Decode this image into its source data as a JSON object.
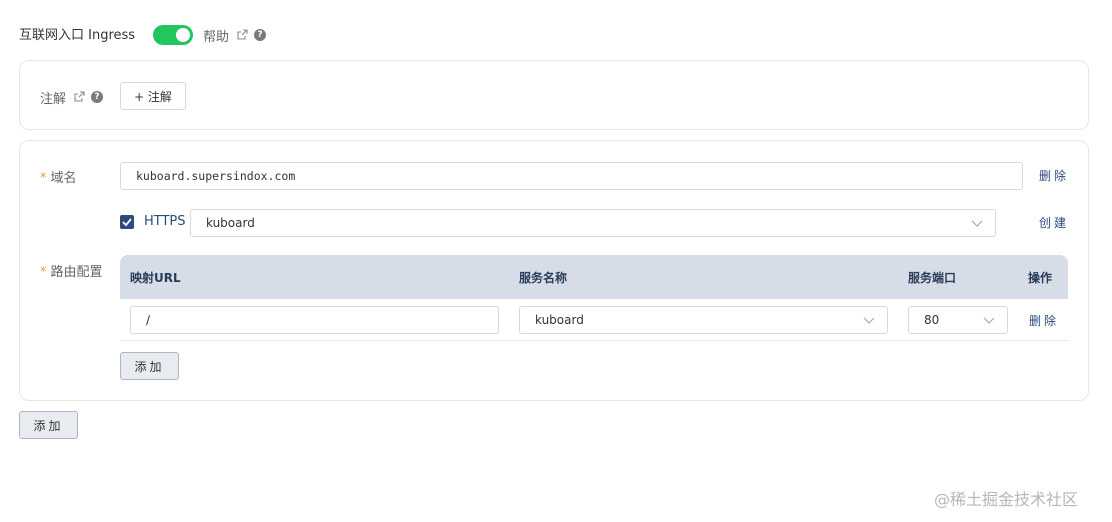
{
  "ingress": {
    "label": "互联网入口 Ingress",
    "enabled": true,
    "help_label": "帮助"
  },
  "annotations": {
    "label": "注解",
    "add_button": "+ 注解"
  },
  "rule": {
    "domain_label": "域名",
    "domain_value": "kuboard.supersindox.com",
    "delete_label": "删除",
    "https_label": "HTTPS",
    "https_checked": true,
    "tls_secret_value": "kuboard",
    "create_label": "创建",
    "paths_label": "路由配置",
    "columns": [
      "映射URL",
      "服务名称",
      "服务端口",
      "操作"
    ],
    "paths": [
      {
        "url": "/",
        "service": "kuboard",
        "port": "80",
        "action": "删除"
      }
    ],
    "add_path_button": "添加"
  },
  "add_rule_button": "添加",
  "watermark": "@稀土掘金技术社区",
  "colors": {
    "toggle_on": "#22c55e",
    "table_header_bg": "#d7dde8",
    "link": "#2c4a7c",
    "required": "#e6a23c"
  }
}
